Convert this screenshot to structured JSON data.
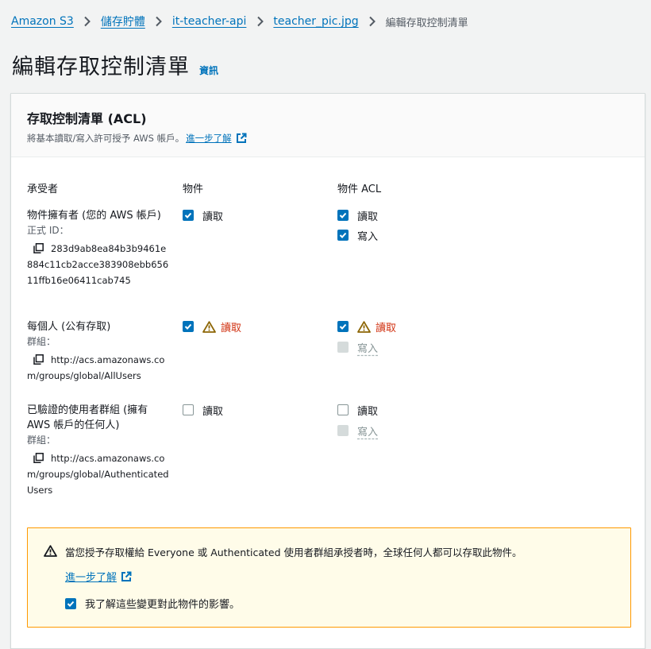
{
  "breadcrumb": {
    "items": [
      "Amazon S3",
      "儲存貯體",
      "it-teacher-api",
      "teacher_pic.jpg"
    ],
    "current": "編輯存取控制清單"
  },
  "page": {
    "title": "編輯存取控制清單",
    "info_link": "資訊"
  },
  "acl_panel": {
    "title": "存取控制清單 (ACL)",
    "description": "將基本讀取/寫入許可授予 AWS 帳戶。",
    "learn_more": "進一步了解",
    "columns": {
      "grantee": "承受者",
      "objects": "物件",
      "object_acl": "物件 ACL"
    },
    "rows": [
      {
        "grantee": "物件擁有者 (您的 AWS 帳戶)",
        "sub_label": "正式 ID：",
        "id_line1": "283d9ab8ea84b3b9461e",
        "id_rest": "884c11cb2acce383908ebb65611ffb16e06411cab745",
        "objects_read": "讀取",
        "acl_read": "讀取",
        "acl_write": "寫入"
      },
      {
        "grantee": "每個人 (公有存取)",
        "sub_label": "群組：",
        "id_line1": "http://acs.amazonaws.co",
        "id_rest": "m/groups/global/AllUsers",
        "objects_read": "讀取",
        "acl_read": "讀取",
        "acl_write": "寫入"
      },
      {
        "grantee": "已驗證的使用者群組 (擁有 AWS 帳戶的任何人)",
        "sub_label": "群組：",
        "id_line1": "http://acs.amazonaws.co",
        "id_rest": "m/groups/global/Authenticated Users",
        "objects_read": "讀取",
        "acl_read": "讀取",
        "acl_write": "寫入"
      }
    ]
  },
  "alert": {
    "message": "當您授予存取權給 Everyone 或 Authenticated 使用者群組承授者時，全球任何人都可以存取此物件。",
    "learn_more": "進一步了解",
    "acknowledge": "我了解這些變更對此物件的影響。"
  },
  "colors": {
    "link": "#0073bb",
    "checkbox": "#0073bb",
    "warning_text": "#d13212",
    "warning_icon": "#8d6605",
    "alert_border": "#ff9900",
    "alert_bg": "#fffce9"
  },
  "icons": [
    "chevron-right-icon",
    "external-link-icon",
    "copy-icon",
    "warning-icon",
    "check-icon"
  ]
}
